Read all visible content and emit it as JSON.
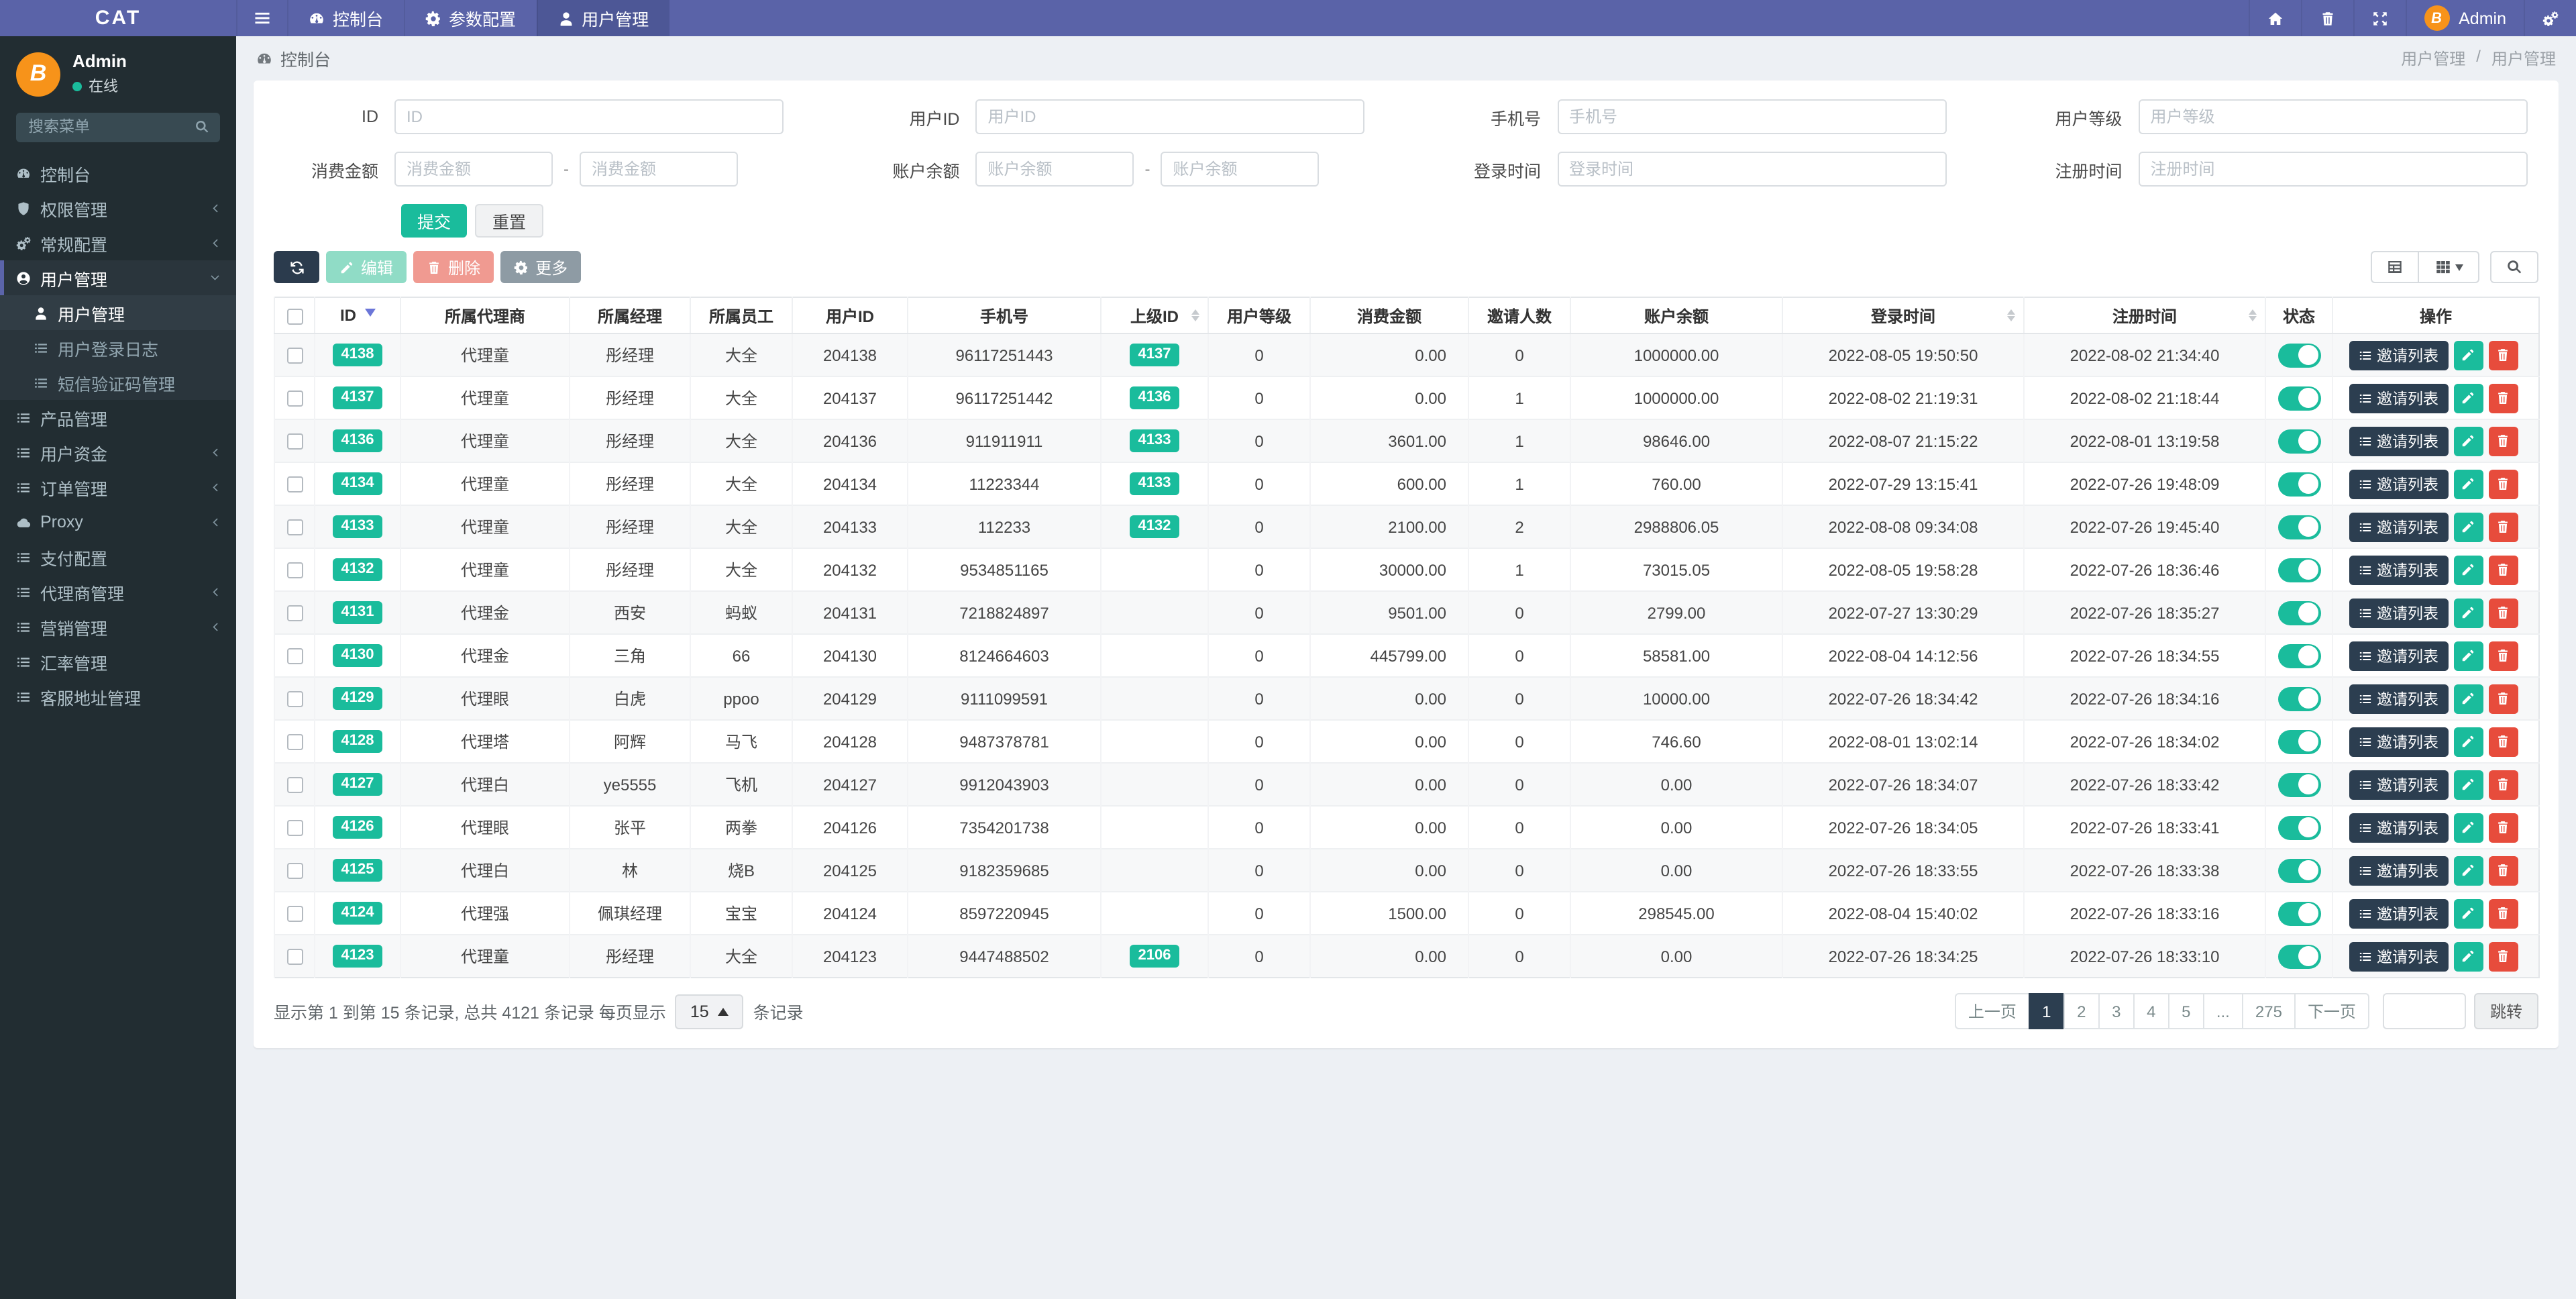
{
  "colors": {
    "accent": "#1abc9c",
    "navbar": "#5a63a8",
    "primary_dark": "#2c3e50",
    "danger": "#e74c3c",
    "avatar_orange": "#f7931a"
  },
  "navbar": {
    "brand": "CAT",
    "items": [
      {
        "icon": "gauge",
        "label": "控制台",
        "active": false
      },
      {
        "icon": "gear",
        "label": "参数配置",
        "active": false
      },
      {
        "icon": "user",
        "label": "用户管理",
        "active": true
      }
    ],
    "right_icons": [
      "home",
      "trash",
      "expand"
    ],
    "user": {
      "name": "Admin",
      "avatar_letter": "B"
    },
    "settings_icon": "gears"
  },
  "sidebar": {
    "user": {
      "name": "Admin",
      "status": "在线",
      "avatar_letter": "B"
    },
    "search_placeholder": "搜索菜单",
    "menu": [
      {
        "icon": "gauge",
        "label": "控制台"
      },
      {
        "icon": "shield",
        "label": "权限管理",
        "arrow": "left"
      },
      {
        "icon": "gears",
        "label": "常规配置",
        "arrow": "left"
      },
      {
        "icon": "user-circle",
        "label": "用户管理",
        "arrow": "down",
        "active": true,
        "children": [
          {
            "icon": "user",
            "label": "用户管理",
            "active": true
          },
          {
            "icon": "list",
            "label": "用户登录日志"
          },
          {
            "icon": "list",
            "label": "短信验证码管理"
          }
        ]
      },
      {
        "icon": "list",
        "label": "产品管理"
      },
      {
        "icon": "list",
        "label": "用户资金",
        "arrow": "left"
      },
      {
        "icon": "list",
        "label": "订单管理",
        "arrow": "left"
      },
      {
        "icon": "cloud",
        "label": "Proxy",
        "arrow": "left"
      },
      {
        "icon": "list",
        "label": "支付配置"
      },
      {
        "icon": "list",
        "label": "代理商管理",
        "arrow": "left"
      },
      {
        "icon": "list",
        "label": "营销管理",
        "arrow": "left"
      },
      {
        "icon": "list",
        "label": "汇率管理"
      },
      {
        "icon": "list",
        "label": "客服地址管理"
      }
    ]
  },
  "breadcrumb": {
    "left": "控制台",
    "crumbs": [
      "用户管理",
      "用户管理"
    ],
    "separator": "/"
  },
  "filters": {
    "id": {
      "label": "ID",
      "placeholder": "ID"
    },
    "user_id": {
      "label": "用户ID",
      "placeholder": "用户ID"
    },
    "phone": {
      "label": "手机号",
      "placeholder": "手机号"
    },
    "level": {
      "label": "用户等级",
      "placeholder": "用户等级"
    },
    "consume": {
      "label": "消费金额",
      "placeholder": "消费金额"
    },
    "balance": {
      "label": "账户余额",
      "placeholder": "账户余额"
    },
    "login_time": {
      "label": "登录时间",
      "placeholder": "登录时间"
    },
    "reg_time": {
      "label": "注册时间",
      "placeholder": "注册时间"
    },
    "separator": "-",
    "submit_label": "提交",
    "reset_label": "重置"
  },
  "toolbar": {
    "edit_label": "编辑",
    "delete_label": "删除",
    "more_label": "更多"
  },
  "table": {
    "invite_label": "邀请列表",
    "columns": [
      {
        "key": "check"
      },
      {
        "label": "ID",
        "sort": "desc"
      },
      {
        "label": "所属代理商"
      },
      {
        "label": "所属经理"
      },
      {
        "label": "所属员工"
      },
      {
        "label": "用户ID"
      },
      {
        "label": "手机号"
      },
      {
        "label": "上级ID",
        "sort": "both"
      },
      {
        "label": "用户等级"
      },
      {
        "label": "消费金额"
      },
      {
        "label": "邀请人数"
      },
      {
        "label": "账户余额"
      },
      {
        "label": "登录时间",
        "sort": "both"
      },
      {
        "label": "注册时间",
        "sort": "both"
      },
      {
        "label": "状态"
      },
      {
        "label": "操作"
      }
    ],
    "rows": [
      {
        "id": "4138",
        "agent": "代理童",
        "manager": "彤经理",
        "staff": "大全",
        "user_id": "204138",
        "phone": "96117251443",
        "parent_id": "4137",
        "level": "0",
        "consume": "0.00",
        "invites": "0",
        "balance": "1000000.00",
        "login_time": "2022-08-05 19:50:50",
        "reg_time": "2022-08-02 21:34:40",
        "status": true
      },
      {
        "id": "4137",
        "agent": "代理童",
        "manager": "彤经理",
        "staff": "大全",
        "user_id": "204137",
        "phone": "96117251442",
        "parent_id": "4136",
        "level": "0",
        "consume": "0.00",
        "invites": "1",
        "balance": "1000000.00",
        "login_time": "2022-08-02 21:19:31",
        "reg_time": "2022-08-02 21:18:44",
        "status": true
      },
      {
        "id": "4136",
        "agent": "代理童",
        "manager": "彤经理",
        "staff": "大全",
        "user_id": "204136",
        "phone": "911911911",
        "parent_id": "4133",
        "level": "0",
        "consume": "3601.00",
        "invites": "1",
        "balance": "98646.00",
        "login_time": "2022-08-07 21:15:22",
        "reg_time": "2022-08-01 13:19:58",
        "status": true
      },
      {
        "id": "4134",
        "agent": "代理童",
        "manager": "彤经理",
        "staff": "大全",
        "user_id": "204134",
        "phone": "11223344",
        "parent_id": "4133",
        "level": "0",
        "consume": "600.00",
        "invites": "1",
        "balance": "760.00",
        "login_time": "2022-07-29 13:15:41",
        "reg_time": "2022-07-26 19:48:09",
        "status": true
      },
      {
        "id": "4133",
        "agent": "代理童",
        "manager": "彤经理",
        "staff": "大全",
        "user_id": "204133",
        "phone": "112233",
        "parent_id": "4132",
        "level": "0",
        "consume": "2100.00",
        "invites": "2",
        "balance": "2988806.05",
        "login_time": "2022-08-08 09:34:08",
        "reg_time": "2022-07-26 19:45:40",
        "status": true
      },
      {
        "id": "4132",
        "agent": "代理童",
        "manager": "彤经理",
        "staff": "大全",
        "user_id": "204132",
        "phone": "9534851165",
        "parent_id": "",
        "level": "0",
        "consume": "30000.00",
        "invites": "1",
        "balance": "73015.05",
        "login_time": "2022-08-05 19:58:28",
        "reg_time": "2022-07-26 18:36:46",
        "status": true
      },
      {
        "id": "4131",
        "agent": "代理金",
        "manager": "西安",
        "staff": "蚂蚁",
        "user_id": "204131",
        "phone": "7218824897",
        "parent_id": "",
        "level": "0",
        "consume": "9501.00",
        "invites": "0",
        "balance": "2799.00",
        "login_time": "2022-07-27 13:30:29",
        "reg_time": "2022-07-26 18:35:27",
        "status": true
      },
      {
        "id": "4130",
        "agent": "代理金",
        "manager": "三角",
        "staff": "66",
        "user_id": "204130",
        "phone": "8124664603",
        "parent_id": "",
        "level": "0",
        "consume": "445799.00",
        "invites": "0",
        "balance": "58581.00",
        "login_time": "2022-08-04 14:12:56",
        "reg_time": "2022-07-26 18:34:55",
        "status": true
      },
      {
        "id": "4129",
        "agent": "代理眼",
        "manager": "白虎",
        "staff": "ppoo",
        "user_id": "204129",
        "phone": "9111099591",
        "parent_id": "",
        "level": "0",
        "consume": "0.00",
        "invites": "0",
        "balance": "10000.00",
        "login_time": "2022-07-26 18:34:42",
        "reg_time": "2022-07-26 18:34:16",
        "status": true
      },
      {
        "id": "4128",
        "agent": "代理塔",
        "manager": "阿辉",
        "staff": "马飞",
        "user_id": "204128",
        "phone": "9487378781",
        "parent_id": "",
        "level": "0",
        "consume": "0.00",
        "invites": "0",
        "balance": "746.60",
        "login_time": "2022-08-01 13:02:14",
        "reg_time": "2022-07-26 18:34:02",
        "status": true
      },
      {
        "id": "4127",
        "agent": "代理白",
        "manager": "ye5555",
        "staff": "飞机",
        "user_id": "204127",
        "phone": "9912043903",
        "parent_id": "",
        "level": "0",
        "consume": "0.00",
        "invites": "0",
        "balance": "0.00",
        "login_time": "2022-07-26 18:34:07",
        "reg_time": "2022-07-26 18:33:42",
        "status": true
      },
      {
        "id": "4126",
        "agent": "代理眼",
        "manager": "张平",
        "staff": "两拳",
        "user_id": "204126",
        "phone": "7354201738",
        "parent_id": "",
        "level": "0",
        "consume": "0.00",
        "invites": "0",
        "balance": "0.00",
        "login_time": "2022-07-26 18:34:05",
        "reg_time": "2022-07-26 18:33:41",
        "status": true
      },
      {
        "id": "4125",
        "agent": "代理白",
        "manager": "林",
        "staff": "烧B",
        "user_id": "204125",
        "phone": "9182359685",
        "parent_id": "",
        "level": "0",
        "consume": "0.00",
        "invites": "0",
        "balance": "0.00",
        "login_time": "2022-07-26 18:33:55",
        "reg_time": "2022-07-26 18:33:38",
        "status": true
      },
      {
        "id": "4124",
        "agent": "代理强",
        "manager": "佩琪经理",
        "staff": "宝宝",
        "user_id": "204124",
        "phone": "8597220945",
        "parent_id": "",
        "level": "0",
        "consume": "1500.00",
        "invites": "0",
        "balance": "298545.00",
        "login_time": "2022-08-04 15:40:02",
        "reg_time": "2022-07-26 18:33:16",
        "status": true
      },
      {
        "id": "4123",
        "agent": "代理童",
        "manager": "彤经理",
        "staff": "大全",
        "user_id": "204123",
        "phone": "9447488502",
        "parent_id": "2106",
        "level": "0",
        "consume": "0.00",
        "invites": "0",
        "balance": "0.00",
        "login_time": "2022-07-26 18:34:25",
        "reg_time": "2022-07-26 18:33:10",
        "status": true
      }
    ]
  },
  "footer": {
    "info_prefix": "显示第 1 到第 15 条记录, 总共 4121 条记录 每页显示",
    "page_size": "15",
    "info_suffix": "条记录",
    "pagination": [
      "上一页",
      "1",
      "2",
      "3",
      "4",
      "5",
      "...",
      "275",
      "下一页"
    ],
    "active_page": "1",
    "jump_label": "跳转"
  }
}
